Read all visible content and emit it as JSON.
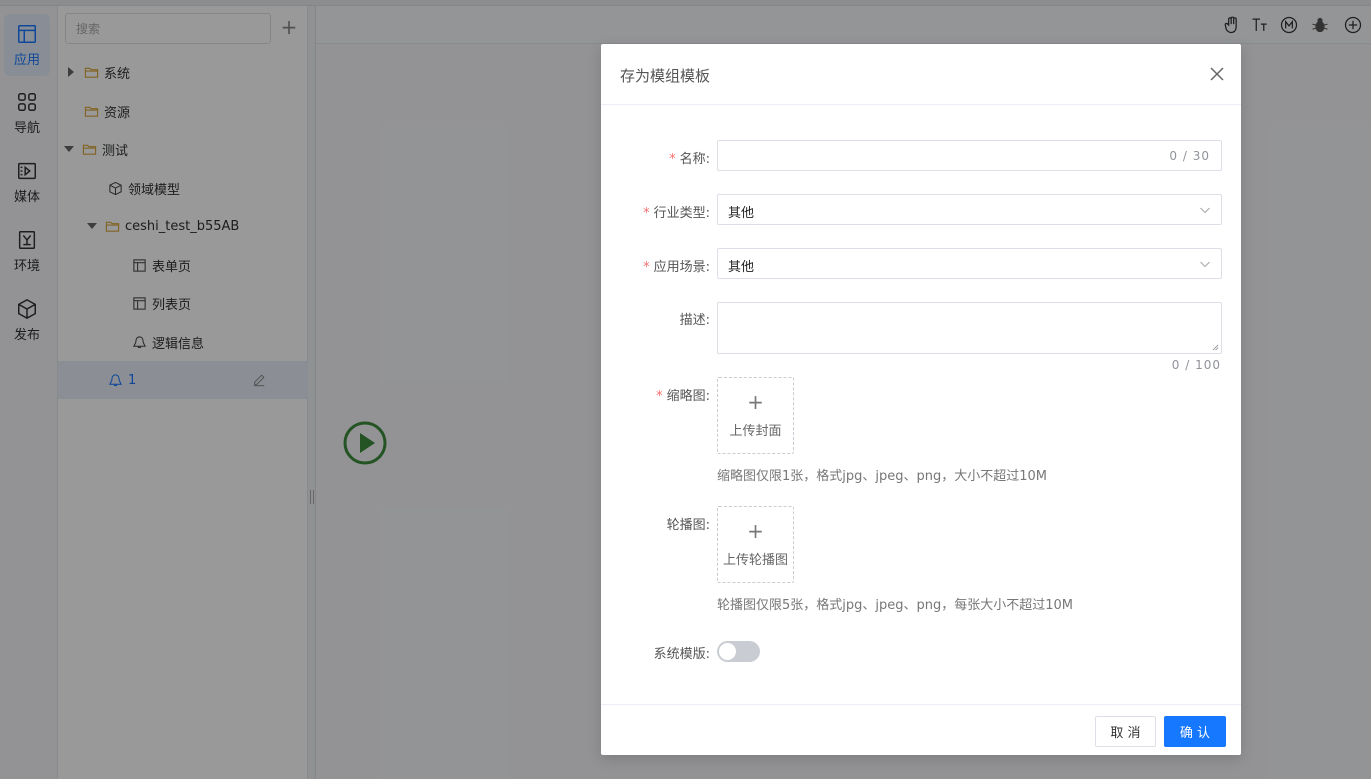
{
  "rail": {
    "items": [
      {
        "label": "应用",
        "icon": "layout-icon",
        "active": true
      },
      {
        "label": "导航",
        "icon": "grid-icon"
      },
      {
        "label": "媒体",
        "icon": "media-icon"
      },
      {
        "label": "环境",
        "icon": "environment-icon"
      },
      {
        "label": "发布",
        "icon": "cube-icon"
      }
    ]
  },
  "tree": {
    "search_placeholder": "搜索",
    "add_label": "+",
    "nodes": [
      {
        "label": "系统",
        "icon": "folder-icon",
        "arrow": "collapsed",
        "level": 0
      },
      {
        "label": "资源",
        "icon": "folder-icon",
        "arrow": "none",
        "level": 0
      },
      {
        "label": "测试",
        "icon": "folder-icon",
        "arrow": "expanded",
        "level": 0
      },
      {
        "label": "领域模型",
        "icon": "cube-icon",
        "arrow": "none",
        "level": 1
      },
      {
        "label": "ceshi_test_b55AB",
        "icon": "folder-icon",
        "arrow": "expanded",
        "level": 1
      },
      {
        "label": "表单页",
        "icon": "page-icon",
        "arrow": "none",
        "level": 2
      },
      {
        "label": "列表页",
        "icon": "page-icon",
        "arrow": "none",
        "level": 2
      },
      {
        "label": "逻辑信息",
        "icon": "logic-icon",
        "arrow": "none",
        "level": 2
      },
      {
        "label": "1",
        "icon": "logic-icon",
        "arrow": "none",
        "level": 1,
        "selected": true
      }
    ]
  },
  "canvas": {
    "tools": [
      "hand-icon",
      "text-size-icon",
      "m-circle-icon",
      "bug-icon",
      "plus-circle-icon"
    ]
  },
  "modal": {
    "title": "存为模组模板",
    "fields": {
      "name": {
        "label": "名称:",
        "value": "",
        "counter": "0 / 30"
      },
      "industry": {
        "label": "行业类型:",
        "value": "其他"
      },
      "scene": {
        "label": "应用场景:",
        "value": "其他"
      },
      "description": {
        "label": "描述:",
        "counter": "0 / 100"
      },
      "thumbnail": {
        "label": "缩略图:",
        "upload_text": "上传封面",
        "hint": "缩略图仅限1张，格式jpg、jpeg、png，大小不超过10M"
      },
      "carousel": {
        "label": "轮播图:",
        "upload_text": "上传轮播图",
        "hint": "轮播图仅限5张，格式jpg、jpeg、png，每张大小不超过10M"
      },
      "system_template": {
        "label": "系统模版:",
        "enabled": false
      }
    },
    "required_mark": "*",
    "plus_glyph": "+",
    "cancel_label": "取 消",
    "confirm_label": "确 认"
  },
  "colors": {
    "primary": "#1677ff",
    "required": "#f56c6c",
    "folder": "#d9a63a",
    "play": "#3d8a3d"
  }
}
